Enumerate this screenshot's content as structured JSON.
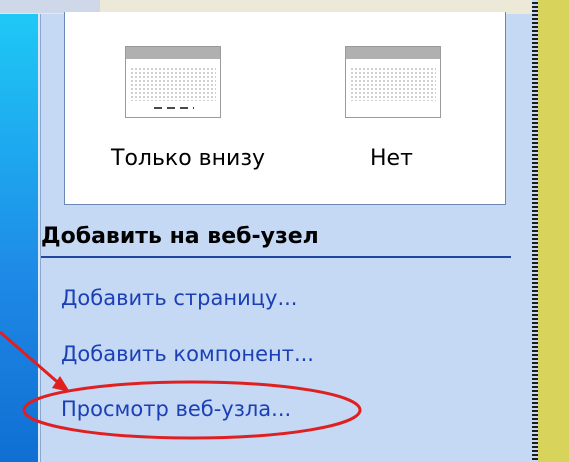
{
  "layout_options": [
    {
      "label": "Только внизу"
    },
    {
      "label": "Нет"
    }
  ],
  "section": {
    "title": "Добавить на веб-узел"
  },
  "links": [
    {
      "label": "Добавить страницу..."
    },
    {
      "label": "Добавить компонент..."
    },
    {
      "label": "Просмотр веб-узла..."
    }
  ],
  "colors": {
    "pane_bg": "#c5d9f5",
    "link": "#1b3fb5",
    "annotation": "#e02020"
  }
}
